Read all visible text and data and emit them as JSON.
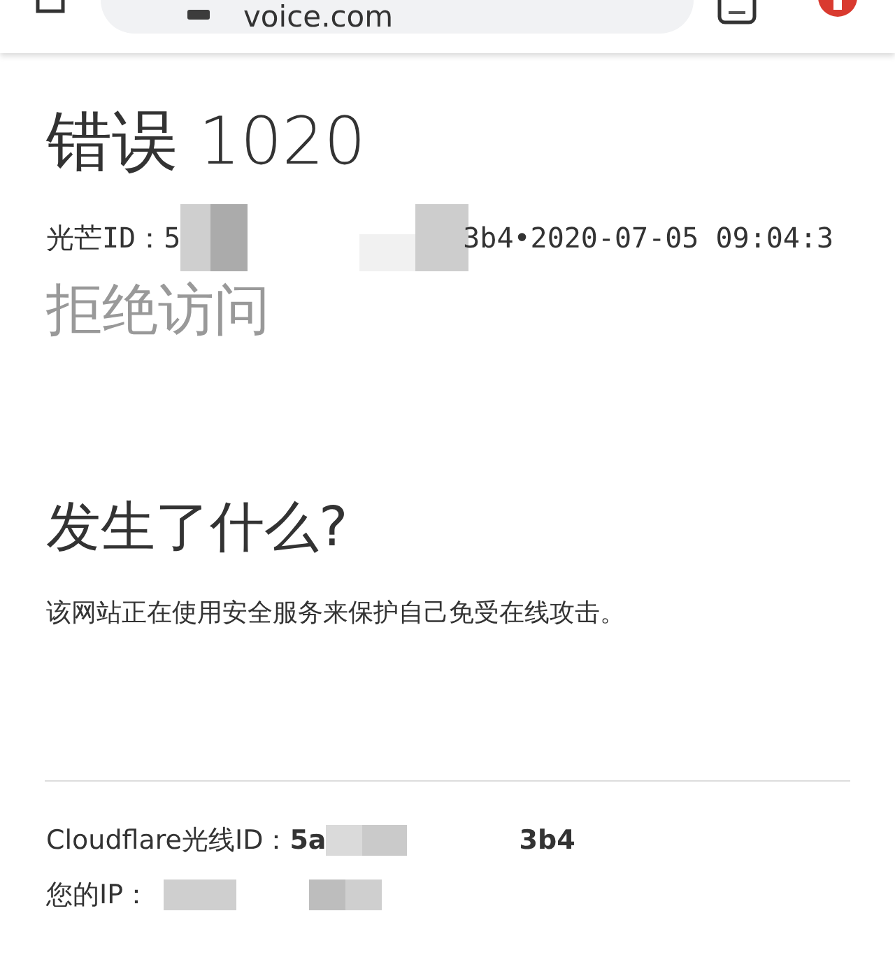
{
  "browser_bar": {
    "url": "voice.com"
  },
  "error": {
    "title": "错误 1020",
    "ray_label": "光芒ID：",
    "ray_start": "5",
    "ray_end": "3b4•2020-07-05 09:04:3",
    "subtitle": "拒绝访问"
  },
  "what_happened": {
    "heading": "发生了什么?",
    "text": "该网站正在使用安全服务来保护自己免受在线攻击。"
  },
  "footer": {
    "ray_label": "Cloudflare光线ID：",
    "ray_start": "5a",
    "ray_end": "3b4",
    "ip_label": "您的IP："
  }
}
